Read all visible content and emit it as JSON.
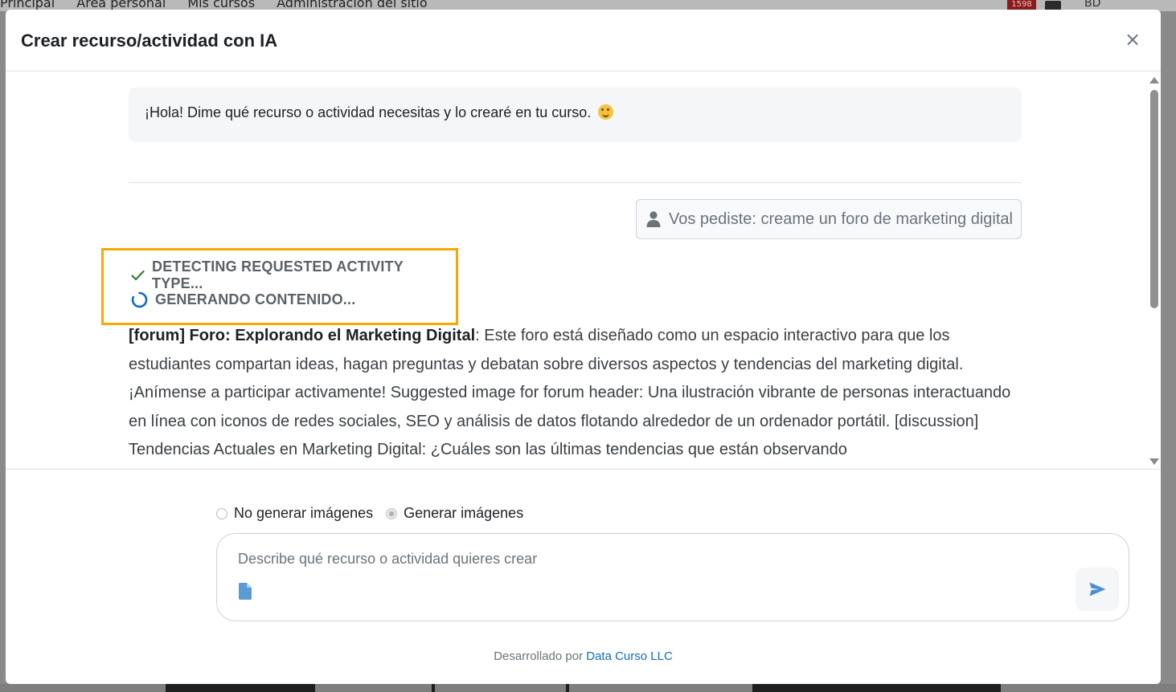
{
  "background": {
    "nav_links": [
      "Principal",
      "Área personal",
      "Mis cursos",
      "Administración del sitio"
    ],
    "notification_count": "1598",
    "user_initials": "BD"
  },
  "modal": {
    "title": "Crear recurso/actividad con IA",
    "close_icon": "close-icon"
  },
  "chat": {
    "greeting": "¡Hola! Dime qué recurso o actividad necesitas y lo crearé en tu curso.",
    "user_request": "Vos pediste: creame un foro de marketing digital",
    "steps": [
      {
        "label": "Detecting requested activity type...",
        "state": "done",
        "icon": "check-icon"
      },
      {
        "label": "Generando contenido...",
        "state": "loading",
        "icon": "spinner-icon"
      }
    ],
    "generated": {
      "heading": "[forum] Foro: Explorando el Marketing Digital",
      "body": ": Este foro está diseñado como un espacio interactivo para que los estudiantes compartan ideas, hagan preguntas y debatan sobre diversos aspectos y tendencias del marketing digital. ¡Anímense a participar activamente! Suggested image for forum header: Una ilustración vibrante de personas interactuando en línea con iconos de redes sociales, SEO y análisis de datos flotando alrededor de un ordenador portátil. [discussion] Tendencias Actuales en Marketing Digital: ¿Cuáles son las últimas tendencias que están observando"
    }
  },
  "image_options": {
    "no_images_label": "No generar imágenes",
    "images_label": "Generar imágenes",
    "selected": "images"
  },
  "composer": {
    "placeholder": "Describe qué recurso o actividad quieres crear",
    "value": "",
    "attach_icon": "file-icon",
    "send_icon": "send-icon"
  },
  "footer": {
    "credit_prefix": "Desarrollado por",
    "credit_link": "Data Curso LLC"
  },
  "colors": {
    "accent": "#0f6cbf",
    "highlight_border": "#f6a800",
    "success": "#357a32",
    "spinner": "#0f6cbf"
  }
}
